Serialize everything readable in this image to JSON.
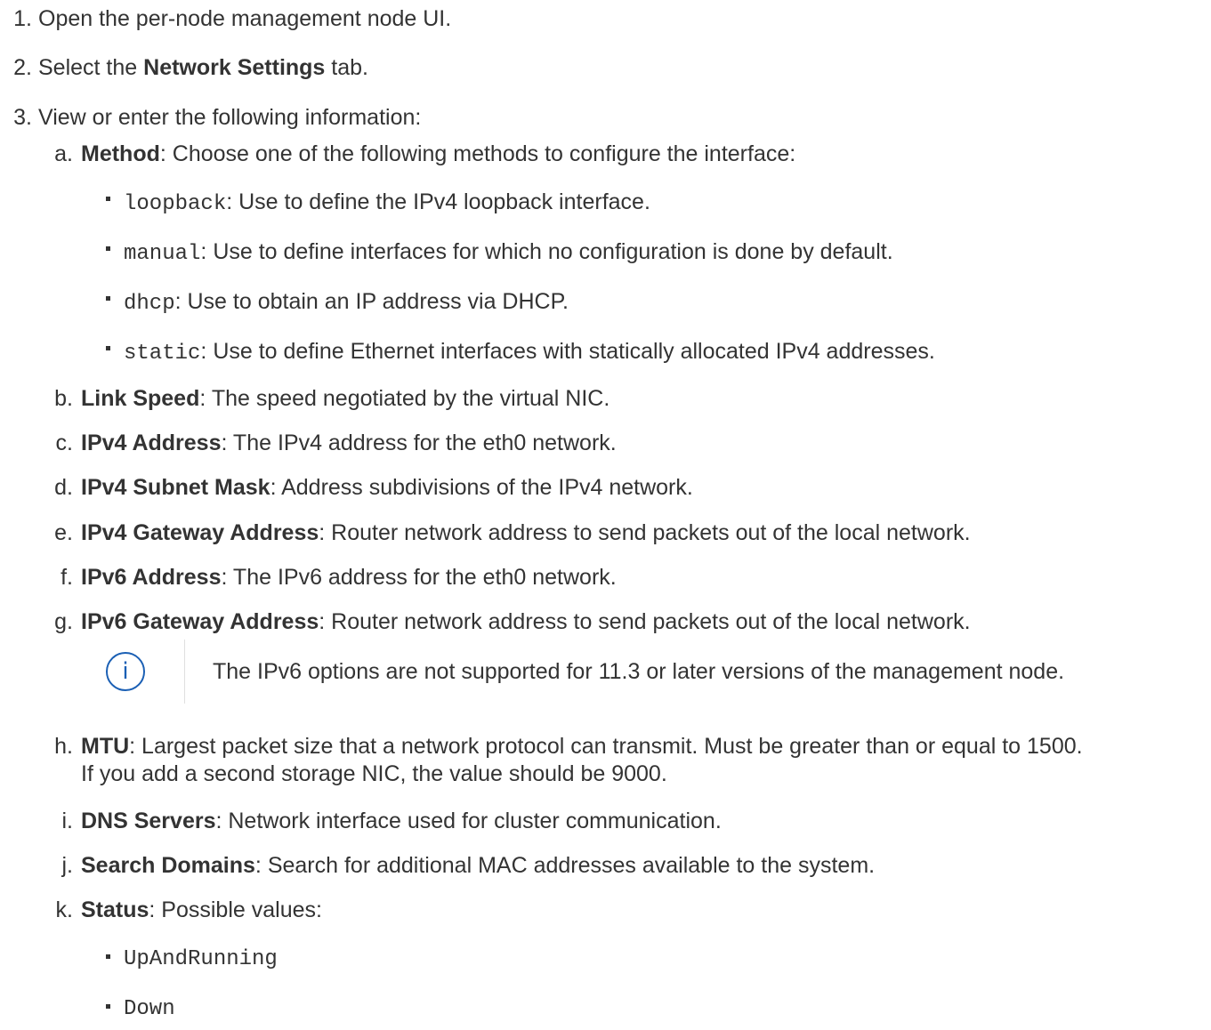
{
  "steps": [
    {
      "marker": "1.",
      "text": "Open the per-node management node UI."
    },
    {
      "marker": "2.",
      "pre": "Select the ",
      "bold": "Network Settings",
      "post": " tab."
    },
    {
      "marker": "3.",
      "text": "View or enter the following information:"
    }
  ],
  "substeps": {
    "a": {
      "marker": "a.",
      "term": "Method",
      "desc": ": Choose one of the following methods to configure the interface:"
    },
    "b": {
      "marker": "b.",
      "term": "Link Speed",
      "desc": ": The speed negotiated by the virtual NIC."
    },
    "c": {
      "marker": "c.",
      "term": "IPv4 Address",
      "desc": ": The IPv4 address for the eth0 network."
    },
    "d": {
      "marker": "d.",
      "term": "IPv4 Subnet Mask",
      "desc": ": Address subdivisions of the IPv4 network."
    },
    "e": {
      "marker": "e.",
      "term": "IPv4 Gateway Address",
      "desc": ": Router network address to send packets out of the local network."
    },
    "f": {
      "marker": "f.",
      "term": "IPv6 Address",
      "desc": ": The IPv6 address for the eth0 network."
    },
    "g": {
      "marker": "g.",
      "term": "IPv6 Gateway Address",
      "desc": ": Router network address to send packets out of the local network."
    },
    "h": {
      "marker": "h.",
      "term": "MTU",
      "desc": ": Largest packet size that a network protocol can transmit. Must be greater than or equal to 1500.",
      "desc2": "If you add a second storage NIC, the value should be 9000."
    },
    "i": {
      "marker": "i.",
      "term": "DNS Servers",
      "desc": ": Network interface used for cluster communication."
    },
    "j": {
      "marker": "j.",
      "term": "Search Domains",
      "desc": ": Search for additional MAC addresses available to the system."
    },
    "k": {
      "marker": "k.",
      "term": "Status",
      "desc": ": Possible values:"
    }
  },
  "methods": [
    {
      "code": "loopback",
      "desc": ": Use to define the IPv4 loopback interface."
    },
    {
      "code": "manual",
      "desc": ": Use to define interfaces for which no configuration is done by default."
    },
    {
      "code": "dhcp",
      "desc": ": Use to obtain an IP address via DHCP."
    },
    {
      "code": "static",
      "desc": ": Use to define Ethernet interfaces with statically allocated IPv4 addresses."
    }
  ],
  "note": {
    "icon": "info-icon",
    "icon_glyph": "i",
    "text": "The IPv6 options are not supported for 11.3 or later versions of the management node."
  },
  "status_values": [
    "UpAndRunning",
    "Down"
  ],
  "colors": {
    "text": "#333333",
    "note_icon": "#1a5fb4"
  }
}
